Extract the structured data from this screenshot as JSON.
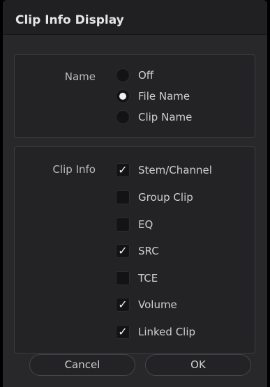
{
  "window": {
    "title": "Clip Info Display"
  },
  "name_group": {
    "label": "Name",
    "options": [
      {
        "label": "Off",
        "selected": false
      },
      {
        "label": "File Name",
        "selected": true
      },
      {
        "label": "Clip Name",
        "selected": false
      }
    ]
  },
  "clip_info_group": {
    "label": "Clip Info",
    "options": [
      {
        "label": "Stem/Channel",
        "checked": true
      },
      {
        "label": "Group Clip",
        "checked": false
      },
      {
        "label": "EQ",
        "checked": false
      },
      {
        "label": "SRC",
        "checked": true
      },
      {
        "label": "TCE",
        "checked": false
      },
      {
        "label": "Volume",
        "checked": true
      },
      {
        "label": "Linked Clip",
        "checked": true
      }
    ]
  },
  "buttons": {
    "cancel": "Cancel",
    "ok": "OK"
  },
  "glyphs": {
    "check": "✓"
  }
}
